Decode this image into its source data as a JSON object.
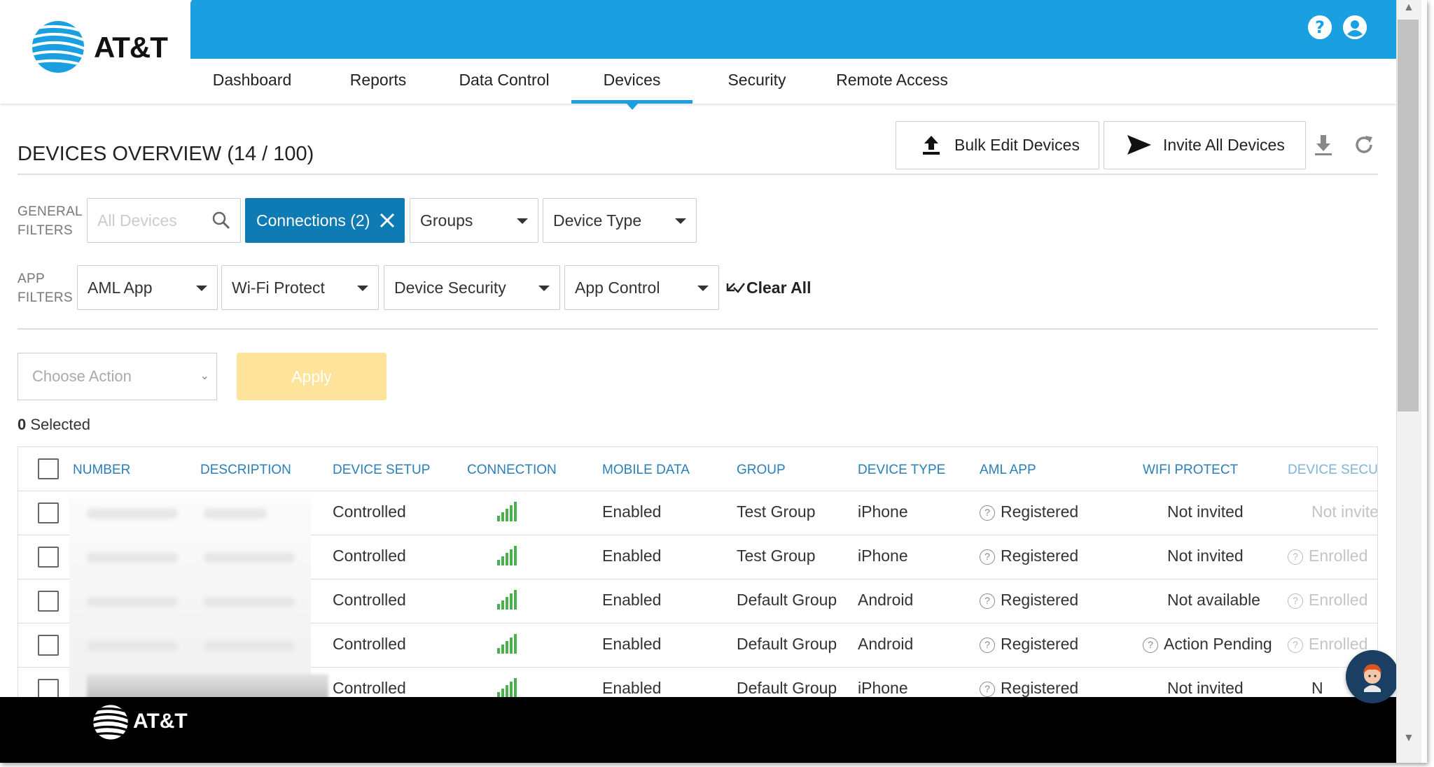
{
  "brand": {
    "name": "AT&T",
    "footer_name": "AT&T"
  },
  "header_icons": [
    "help-icon",
    "user-account-icon"
  ],
  "nav": {
    "tabs": [
      {
        "label": "Dashboard"
      },
      {
        "label": "Reports"
      },
      {
        "label": "Data Control"
      },
      {
        "label": "Devices",
        "active": true
      },
      {
        "label": "Security"
      },
      {
        "label": "Remote Access"
      }
    ]
  },
  "overview": {
    "title": "DEVICES OVERVIEW (14 / 100)",
    "bulk_edit_label": "Bulk Edit Devices",
    "invite_all_label": "Invite All Devices"
  },
  "filters": {
    "general_label_1": "GENERAL",
    "general_label_2": "FILTERS",
    "search_placeholder": "All Devices",
    "connections_chip": "Connections (2)",
    "groups": "Groups",
    "device_type": "Device Type",
    "app_label_1": "APP",
    "app_label_2": "FILTERS",
    "aml_app": "AML App",
    "wifi_protect": "Wi-Fi Protect",
    "device_security": "Device Security",
    "app_control": "App Control",
    "clear_all": "Clear All"
  },
  "actions": {
    "choose_action": "Choose Action",
    "apply": "Apply",
    "selected_count": "0",
    "selected_label": " Selected"
  },
  "table": {
    "headers": [
      "NUMBER",
      "DESCRIPTION",
      "DEVICE SETUP",
      "CONNECTION",
      "MOBILE DATA",
      "GROUP",
      "DEVICE TYPE",
      "AML APP",
      "WIFI PROTECT",
      "DEVICE SECURI"
    ],
    "rows": [
      {
        "device_setup": "Controlled",
        "mobile_data": "Enabled",
        "group": "Test Group",
        "device_type": "iPhone",
        "aml_app": "Registered",
        "wifi_protect": "Not invited",
        "device_security": "Not invite"
      },
      {
        "device_setup": "Controlled",
        "mobile_data": "Enabled",
        "group": "Test Group",
        "device_type": "iPhone",
        "aml_app": "Registered",
        "wifi_protect": "Not invited",
        "device_security": "Enrolled"
      },
      {
        "device_setup": "Controlled",
        "mobile_data": "Enabled",
        "group": "Default Group",
        "device_type": "Android",
        "aml_app": "Registered",
        "wifi_protect": "Not available",
        "device_security": "Enrolled"
      },
      {
        "device_setup": "Controlled",
        "mobile_data": "Enabled",
        "group": "Default Group",
        "device_type": "Android",
        "aml_app": "Registered",
        "wifi_protect": "Action Pending",
        "device_security": "Enrolled"
      },
      {
        "device_setup": "Controlled",
        "mobile_data": "Enabled",
        "group": "Default Group",
        "device_type": "iPhone",
        "aml_app": "Registered",
        "wifi_protect": "Not invited",
        "device_security": "N"
      }
    ]
  },
  "colors": {
    "brand_blue": "#1aa0e0",
    "chip_blue": "#0e7bb5",
    "apply_disabled": "#fde49a",
    "signal_green": "#4caf50"
  }
}
